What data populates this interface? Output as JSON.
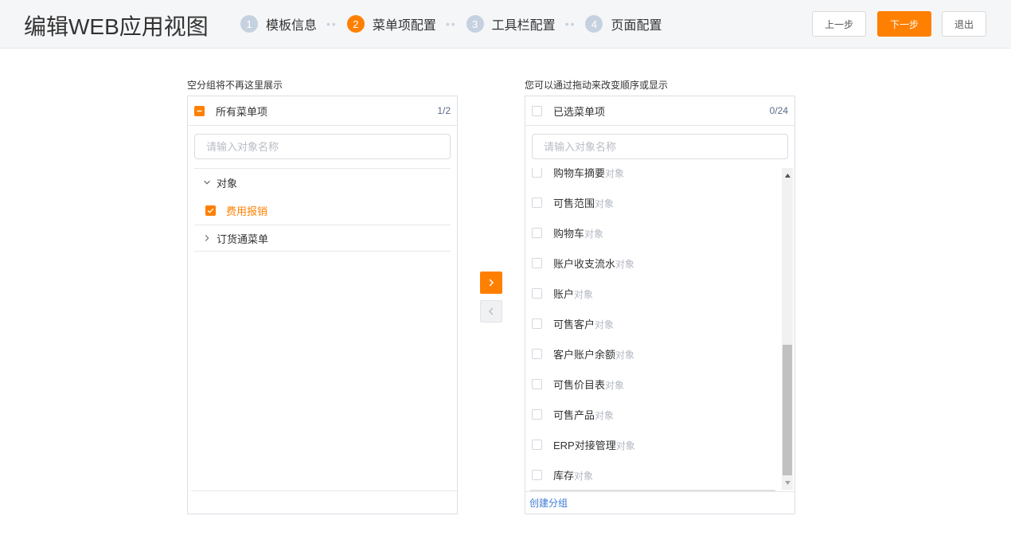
{
  "header": {
    "title": "编辑WEB应用视图",
    "steps": [
      {
        "num": "1",
        "label": "模板信息",
        "active": false
      },
      {
        "num": "2",
        "label": "菜单项配置",
        "active": true
      },
      {
        "num": "3",
        "label": "工具栏配置",
        "active": false
      },
      {
        "num": "4",
        "label": "页面配置",
        "active": false
      }
    ],
    "step_separator": "••",
    "prev_label": "上一步",
    "next_label": "下一步",
    "exit_label": "退出"
  },
  "left": {
    "caption": "空分组将不再这里展示",
    "head_label": "所有菜单项",
    "count": "1/2",
    "search_placeholder": "请输入对象名称",
    "tree": [
      {
        "label": "对象",
        "expanded": true,
        "children": [
          {
            "label": "费用报销",
            "checked": true
          }
        ]
      },
      {
        "label": "订货通菜单",
        "expanded": false
      }
    ]
  },
  "right": {
    "caption": "您可以通过拖动来改变顺序或显示",
    "head_label": "已选菜单项",
    "count": "0/24",
    "search_placeholder": "请输入对象名称",
    "tag": "对象",
    "items": [
      {
        "name": "购物车摘要",
        "tag": "对象"
      },
      {
        "name": "可售范围",
        "tag": "对象"
      },
      {
        "name": "购物车",
        "tag": "对象"
      },
      {
        "name": "账户收支流水",
        "tag": "对象"
      },
      {
        "name": "账户",
        "tag": "对象"
      },
      {
        "name": "可售客户",
        "tag": "对象"
      },
      {
        "name": "客户账户余额",
        "tag": "对象"
      },
      {
        "name": "可售价目表",
        "tag": "对象"
      },
      {
        "name": "可售产品",
        "tag": "对象"
      },
      {
        "name": "ERP对接管理",
        "tag": "对象"
      },
      {
        "name": "库存",
        "tag": "对象"
      }
    ],
    "create_group_label": "创建分组"
  },
  "colors": {
    "accent": "#ff8000",
    "link": "#3a7bd5",
    "step_inactive": "#c6d1e0"
  }
}
